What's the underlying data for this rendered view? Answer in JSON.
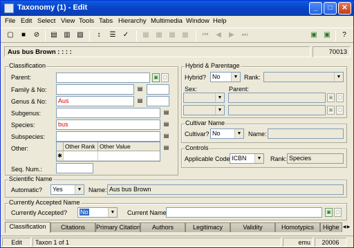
{
  "window": {
    "title": "Taxonomy (1) - Edit",
    "min": "_",
    "max": "□",
    "close": "✕"
  },
  "menu": [
    "File",
    "Edit",
    "Select",
    "View",
    "Tools",
    "Tabs",
    "Hierarchy",
    "Multimedia",
    "Window",
    "Help"
  ],
  "header": {
    "name": "Aus bus Brown : : : :",
    "irn": "70013"
  },
  "classification": {
    "title": "Classification",
    "parent_label": "Parent:",
    "family_label": "Family & No:",
    "genus_label": "Genus & No:",
    "genus_value": "Aus",
    "subgenus_label": "Subgenus:",
    "species_label": "Species:",
    "species_value": "bus",
    "subspecies_label": "Subspecies:",
    "other_label": "Other:",
    "other_rank_header": "Other Rank",
    "other_value_header": "Other Value",
    "new_row_marker": "✱",
    "seq_label": "Seq. Num.:"
  },
  "hybrid": {
    "title": "Hybrid & Parentage",
    "hybrid_label": "Hybrid?",
    "hybrid_value": "No",
    "rank_label": "Rank:",
    "sex_label": "Sex:",
    "parent_label": "Parent:"
  },
  "cultivar": {
    "title": "Cultivar Name",
    "cultivar_label": "Cultivar?",
    "cultivar_value": "No",
    "name_label": "Name:"
  },
  "controls": {
    "title": "Controls",
    "code_label": "Applicable Code:",
    "code_value": "ICBN",
    "rank_label": "Rank:",
    "rank_value": "Species"
  },
  "scientific": {
    "title": "Scientific Name",
    "automatic_label": "Automatic?",
    "automatic_value": "Yes",
    "name_label": "Name:",
    "name_value": "Aus bus Brown"
  },
  "accepted": {
    "title": "Currently Accepted Name",
    "accepted_label": "Currently Accepted?",
    "accepted_value": "No",
    "current_label": "Current Name:"
  },
  "tabs": [
    "Classification",
    "Citations",
    "Primary Citation",
    "Authors",
    "Legitimacy",
    "Validity",
    "Homotypics",
    "Highe"
  ],
  "status": {
    "mode": "Edit",
    "record": "Taxon 1 of 1",
    "user": "emu",
    "number": "20006"
  }
}
